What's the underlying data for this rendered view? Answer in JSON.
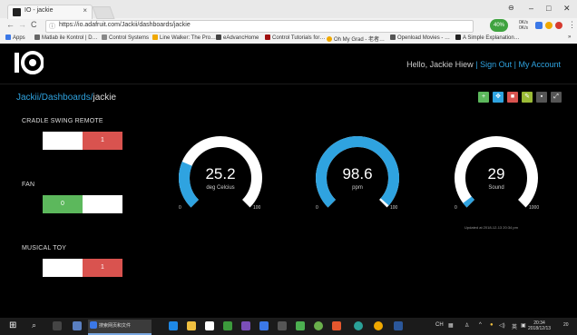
{
  "browser": {
    "tab_title": "IO - jackie",
    "tab_close": "×",
    "url": "https://io.adafruit.com/Jackii/dashboards/jackie",
    "controls": {
      "minimize": "–",
      "maximize": "□",
      "close": "✕"
    },
    "nav": {
      "back": "←",
      "forward": "→",
      "reload": "C"
    },
    "badge_percent": "40%",
    "net_speed": [
      "0K/s",
      "0K/s"
    ],
    "bookmarks": [
      {
        "label": "Apps",
        "color": "#3b78e7"
      },
      {
        "label": "Matlab ile Kontrol | D…",
        "color": "#666666"
      },
      {
        "label": "Control Systems",
        "color": "#888888"
      },
      {
        "label": "Line Walker: The Pro…",
        "color": "#f0a800"
      },
      {
        "label": "eAdvancHome",
        "color": "#444444"
      },
      {
        "label": "Control Tutorials for…",
        "color": "#a01010"
      },
      {
        "label": "Oh My Grad - 老者…",
        "color": "#f0a800"
      },
      {
        "label": "Openload Movies - …",
        "color": "#555555"
      },
      {
        "label": "A Simple Explanation…",
        "color": "#222222"
      }
    ],
    "bookmarks_more": "»"
  },
  "header": {
    "greeting": "Hello, Jackie Hiew",
    "separator1": "|",
    "sign_out": "Sign Out",
    "separator2": "|",
    "my_account": "My Account"
  },
  "breadcrumb": {
    "user": "Jackii",
    "sep1": "/",
    "section": "Dashboards",
    "sep2": "/",
    "current": "jackie"
  },
  "toolbar": [
    {
      "name": "add-block-button",
      "symbol": "+",
      "color": "#5cb85c"
    },
    {
      "name": "edit-layout-button",
      "symbol": "✥",
      "color": "#2fa3e0"
    },
    {
      "name": "delete-block-button",
      "symbol": "■",
      "color": "#d9534f"
    },
    {
      "name": "settings-button",
      "symbol": "✎",
      "color": "#9bbb36"
    },
    {
      "name": "lock-button",
      "symbol": "▪",
      "color": "#555555"
    },
    {
      "name": "fullscreen-button",
      "symbol": "⤢",
      "color": "#555555"
    }
  ],
  "toggles": [
    {
      "label": "CRADLE SWING REMOTE",
      "state_text": "1",
      "state": "on"
    },
    {
      "label": "FAN",
      "state_text": "0",
      "state": "off"
    },
    {
      "label": "MUSICAL TOY",
      "state_text": "1",
      "state": "on"
    }
  ],
  "gauges": [
    {
      "value": "25.2",
      "unit": "deg Celcius",
      "min": "0",
      "max": "100",
      "level": 0.252
    },
    {
      "value": "98.6",
      "unit": "ppm",
      "min": "0",
      "max": "100",
      "level": 0.986
    },
    {
      "value": "29",
      "unit": "Sound",
      "min": "0",
      "max": "1000",
      "level": 0.029
    }
  ],
  "last_updated": "Updated at 2018-12-13 20:34 pm",
  "colors": {
    "accent": "#2fa3e0",
    "on_red": "#d9534f",
    "off_green": "#5cb85c",
    "gauge_track": "#ffffff"
  },
  "taskbar": {
    "active_window": "搜索网页和文件",
    "tray_lang": "CH",
    "tray_ime": "英",
    "time": "20:34",
    "date": "2018/12/13",
    "notif_count": "20"
  }
}
